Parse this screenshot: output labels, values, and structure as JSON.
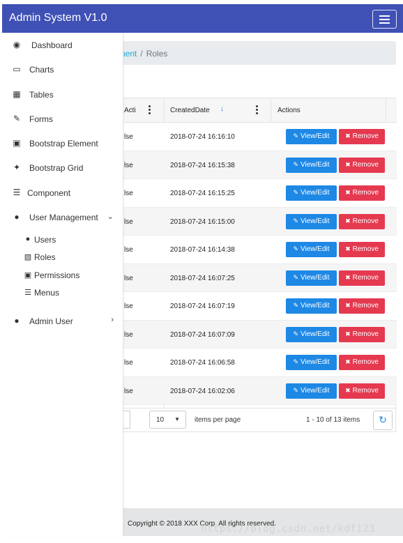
{
  "header": {
    "brand": "Admin System V1.0",
    "toggle_icon": "hamburger-icon",
    "accent": "#3f51b5"
  },
  "breadcrumb": {
    "parent": "nent",
    "separator": "/",
    "current": "Roles"
  },
  "sidebar": {
    "items": [
      {
        "label": "Dashboard",
        "icon": "dashboard-icon"
      },
      {
        "label": "Charts",
        "icon": "bar-chart-icon"
      },
      {
        "label": "Tables",
        "icon": "table-icon"
      },
      {
        "label": "Forms",
        "icon": "edit-icon"
      },
      {
        "label": "Bootstrap Element",
        "icon": "desktop-icon"
      },
      {
        "label": "Bootstrap Grid",
        "icon": "wrench-icon"
      },
      {
        "label": "Component",
        "icon": "list-icon"
      },
      {
        "label": "User Management",
        "icon": "users-icon",
        "expanded": true
      },
      {
        "label": "Admin User",
        "icon": "user-icon"
      }
    ],
    "subitems": [
      {
        "label": "Users",
        "icon": "user-icon"
      },
      {
        "label": "Roles",
        "icon": "sitemap-icon"
      },
      {
        "label": "Permissions",
        "icon": "lock-icon"
      },
      {
        "label": "Menus",
        "icon": "menu-icon"
      }
    ]
  },
  "grid": {
    "columns": {
      "active": "Acti",
      "created": "CreatedDate",
      "actions": "Actions"
    },
    "sort_icon": "sort-descending-icon",
    "rows": [
      {
        "active": "lse",
        "created": "2018-07-24 16:16:10"
      },
      {
        "active": "lse",
        "created": "2018-07-24 16:15:38"
      },
      {
        "active": "lse",
        "created": "2018-07-24 16:15:25"
      },
      {
        "active": "lse",
        "created": "2018-07-24 16:15:00"
      },
      {
        "active": "lse",
        "created": "2018-07-24 16:14:38"
      },
      {
        "active": "lse",
        "created": "2018-07-24 16:07:25"
      },
      {
        "active": "lse",
        "created": "2018-07-24 16:07:19"
      },
      {
        "active": "lse",
        "created": "2018-07-24 16:07:09"
      },
      {
        "active": "lse",
        "created": "2018-07-24 16:06:58"
      },
      {
        "active": "lse",
        "created": "2018-07-24 16:02:06"
      }
    ],
    "view_label": "View/Edit",
    "remove_label": "Remove",
    "view_color": "#1e88e5",
    "remove_color": "#e53950"
  },
  "pager": {
    "page_size": "10",
    "page_size_label": "items per page",
    "info": "1 - 10 of 13 items",
    "refresh_icon": "refresh-icon"
  },
  "footer": {
    "copyright": "Copyright © 2018 XXX Corp. All rights reserved."
  },
  "watermark": "https://blog.csdn.net/kdf123"
}
